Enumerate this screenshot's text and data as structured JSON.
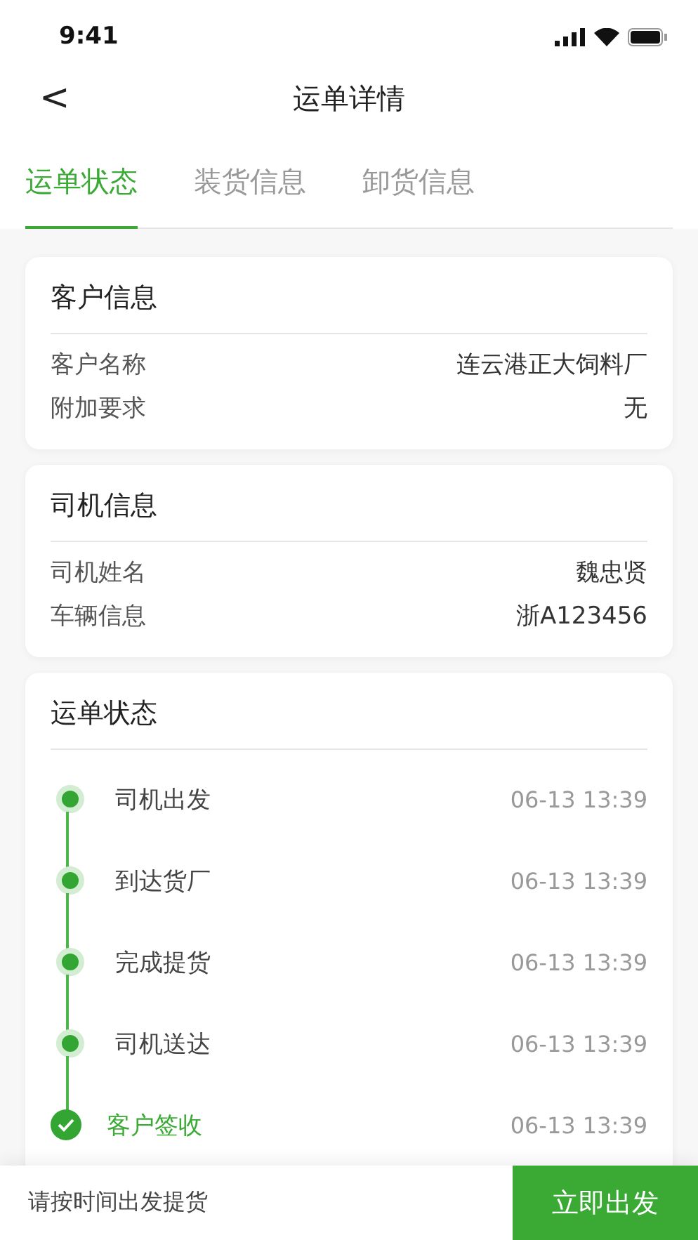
{
  "status_bar": {
    "time": "9:41"
  },
  "nav": {
    "back": "<",
    "title": "运单详情"
  },
  "tabs": [
    {
      "label": "运单状态",
      "selected": true
    },
    {
      "label": "装货信息",
      "selected": false
    },
    {
      "label": "卸货信息",
      "selected": false
    }
  ],
  "cards": [
    {
      "title": "客户信息",
      "rows": [
        {
          "label": "客户名称",
          "value": "连云港正大饲料厂"
        },
        {
          "label": "附加要求",
          "value": "无"
        }
      ]
    },
    {
      "title": "司机信息",
      "rows": [
        {
          "label": "司机姓名",
          "value": "魏忠贤"
        },
        {
          "label": "车辆信息",
          "value": "浙A123456"
        }
      ]
    }
  ],
  "timeline": {
    "title": "运单状态",
    "steps": [
      {
        "label": "司机出发",
        "time": "06-13 13:39",
        "done": false
      },
      {
        "label": "到达货厂",
        "time": "06-13 13:39",
        "done": false
      },
      {
        "label": "完成提货",
        "time": "06-13 13:39",
        "done": false
      },
      {
        "label": "司机送达",
        "time": "06-13 13:39",
        "done": false
      },
      {
        "label": "客户签收",
        "time": "06-13 13:39",
        "done": true
      }
    ]
  },
  "bottom_bar": {
    "hint": "请按时间出发提货",
    "button": "立即出发"
  }
}
